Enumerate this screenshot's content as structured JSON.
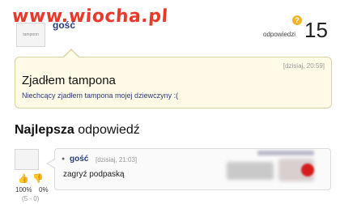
{
  "watermark": "www.wiocha.pl",
  "question": {
    "username": "gość",
    "answers_badge": "?",
    "answers_label": "odpowiedzi",
    "answers_count": "15",
    "avatar_text": "tampoon",
    "timestamp": "[dzisiaj, 20:59]",
    "title": "Zjadłem tampona",
    "body": "Niechcący zjadłem tampona mojej dziewczyny :("
  },
  "best_answer": {
    "heading_bold": "Najlepsza",
    "heading_rest": " odpowiedź",
    "bullet": "●",
    "username": "gość",
    "timestamp": "[dzisiaj, 21:03]",
    "text": "zagryź podpaską",
    "up_percent": "100%",
    "down_percent": "0%",
    "votes": "(5 - 0)"
  },
  "icons": {
    "thumb_up": "👍",
    "thumb_down": "👎"
  },
  "colors": {
    "watermark": "#e83a2b",
    "username": "#2a3b7a",
    "question_bg": "#fffbe6",
    "badge": "#f0b429"
  }
}
